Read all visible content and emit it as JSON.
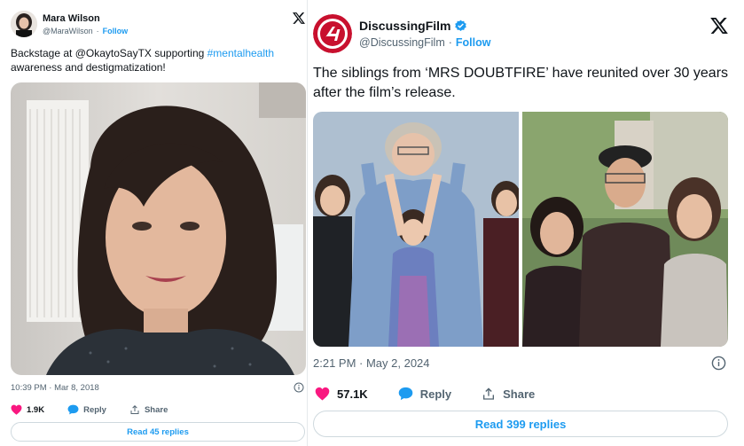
{
  "left_tweet": {
    "author_name": "Mara Wilson",
    "author_handle": "@MaraWilson",
    "separator": "·",
    "follow_label": "Follow",
    "text_before": "Backstage at @OkaytoSayTX supporting ",
    "hashtag": "#mentalhealth",
    "text_after": " awareness and destigmatization!",
    "timestamp": "10:39 PM · Mar 8, 2018",
    "like_count": "1.9K",
    "reply_label": "Reply",
    "share_label": "Share",
    "read_replies_label": "Read 45 replies",
    "icons": [
      "x-logo-icon",
      "info-icon",
      "heart-icon",
      "reply-bubble-icon",
      "share-icon"
    ]
  },
  "right_tweet": {
    "author_name": "DiscussingFilm",
    "author_handle": "@DiscussingFilm",
    "separator": "·",
    "follow_label": "Follow",
    "text": "The siblings from ‘MRS DOUBTFIRE’ have reunited over 30 years after the film’s release.",
    "timestamp": "2:21 PM · May 2, 2024",
    "like_count": "57.1K",
    "reply_label": "Reply",
    "share_label": "Share",
    "read_replies_label": "Read 399 replies",
    "icons": [
      "x-logo-icon",
      "verified-badge-icon",
      "info-icon",
      "heart-icon",
      "reply-bubble-icon",
      "share-icon"
    ]
  },
  "colors": {
    "link_blue": "#1d9bf0",
    "heart_pink": "#f91880",
    "muted_text": "#536471",
    "border": "#cfd9de",
    "brand_red": "#c8102e"
  }
}
